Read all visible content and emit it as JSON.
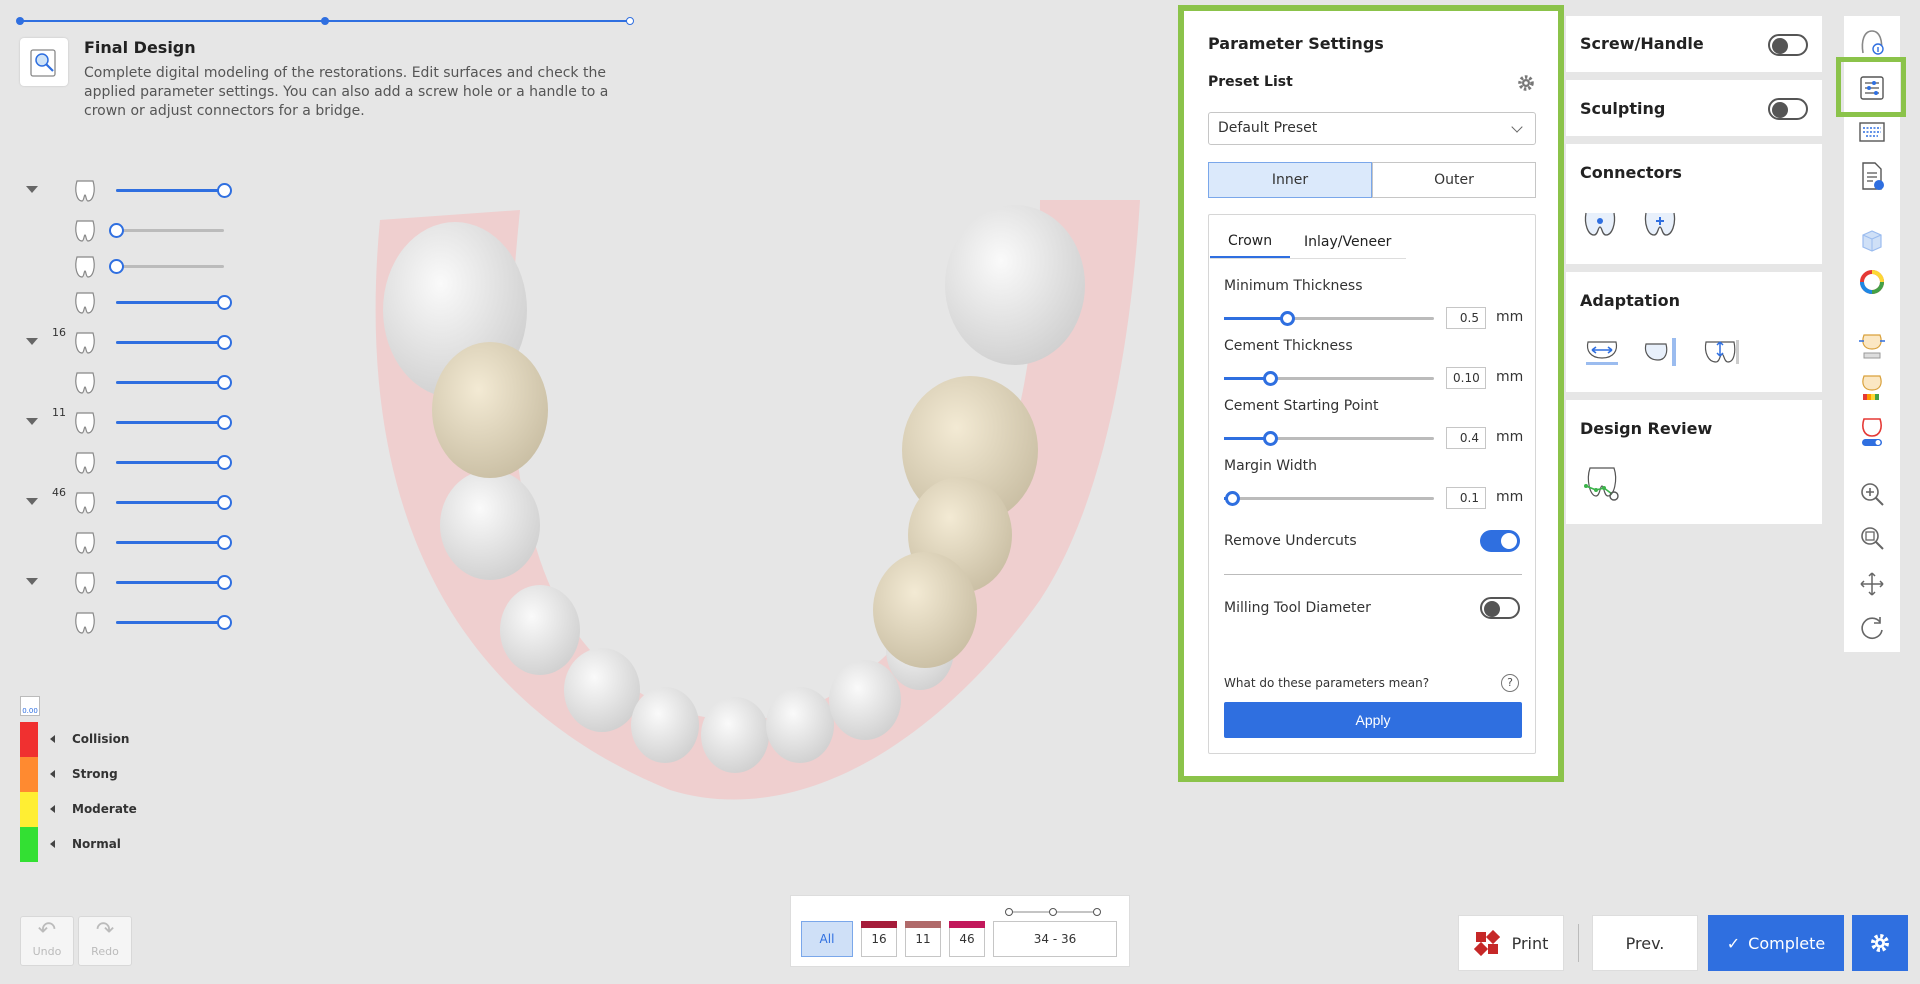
{
  "step": {
    "title": "Final Design",
    "description": "Complete digital modeling of the restorations. Edit surfaces and check the applied parameter settings. You can also add a screw hole or a handle to a crown or adjust connectors for a bridge."
  },
  "layers": [
    {
      "tooth": "",
      "level": 1.0
    },
    {
      "tooth": "",
      "level": 0.0
    },
    {
      "tooth": "",
      "level": 0.0
    },
    {
      "tooth": "",
      "level": 1.0
    },
    {
      "tooth": "16",
      "level": 1.0
    },
    {
      "tooth": "",
      "level": 1.0
    },
    {
      "tooth": "11",
      "level": 1.0
    },
    {
      "tooth": "",
      "level": 1.0
    },
    {
      "tooth": "46",
      "level": 1.0
    },
    {
      "tooth": "",
      "level": 1.0
    },
    {
      "tooth": "",
      "level": 1.0
    },
    {
      "tooth": "",
      "level": 1.0
    }
  ],
  "legend": {
    "scale_value": "0.00",
    "items": [
      {
        "label": "Collision",
        "color": "#f03030"
      },
      {
        "label": "Strong",
        "color": "#ff8a30"
      },
      {
        "label": "Moderate",
        "color": "#ffee33"
      },
      {
        "label": "Normal",
        "color": "#33e033"
      }
    ]
  },
  "history": {
    "undo": "Undo",
    "redo": "Redo"
  },
  "parameter_settings": {
    "title": "Parameter Settings",
    "preset_label": "Preset List",
    "preset_value": "Default Preset",
    "segments": [
      "Inner",
      "Outer"
    ],
    "tabs": [
      "Crown",
      "Inlay/Veneer"
    ],
    "params": [
      {
        "label": "Minimum Thickness",
        "value": "0.5",
        "unit": "mm",
        "level": 0.3
      },
      {
        "label": "Cement Thickness",
        "value": "0.10",
        "unit": "mm",
        "level": 0.22
      },
      {
        "label": "Cement Starting Point",
        "value": "0.4",
        "unit": "mm",
        "level": 0.22
      },
      {
        "label": "Margin Width",
        "value": "0.1",
        "unit": "mm",
        "level": 0.04
      }
    ],
    "remove_undercuts": "Remove Undercuts",
    "milling_tool": "Milling Tool Diameter",
    "help_text": "What do these parameters mean?",
    "help_icon": "?",
    "apply": "Apply"
  },
  "cards": {
    "screw_handle": "Screw/Handle",
    "sculpting": "Sculpting",
    "connectors": "Connectors",
    "adaptation": "Adaptation",
    "design_review": "Design Review"
  },
  "bottom": {
    "all": "All",
    "teeth": [
      {
        "label": "16",
        "color": "#a51c3a"
      },
      {
        "label": "11",
        "color": "#b06a6a"
      },
      {
        "label": "46",
        "color": "#c2185b"
      }
    ],
    "range": "34 - 36"
  },
  "actions": {
    "print": "Print",
    "prev": "Prev.",
    "complete": "Complete",
    "complete_icon": "✓"
  }
}
